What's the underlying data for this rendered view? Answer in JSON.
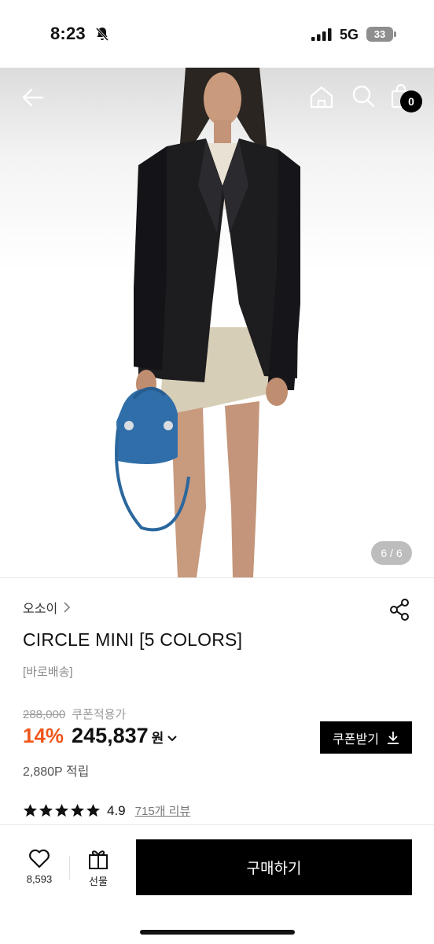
{
  "status_bar": {
    "time": "8:23",
    "network": "5G",
    "battery": "33"
  },
  "hero": {
    "page_counter": "6 / 6",
    "cart_count": "0"
  },
  "product": {
    "brand": "오소이",
    "title": "CIRCLE MINI [5 COLORS]",
    "shipping_tag": "[바로배송]",
    "original_price": "288,000",
    "coupon_price_label": "쿠폰적용가",
    "discount": "14%",
    "price": "245,837",
    "currency": "원",
    "coupon_button_label": "쿠폰받기",
    "points": "2,880P 적립",
    "rating": "4.9",
    "rating_value": 4.9,
    "review_link": "715개 리뷰"
  },
  "bottom_bar": {
    "wish_count": "8,593",
    "gift_label": "선물",
    "buy_label": "구매하기"
  },
  "colors": {
    "accent_discount": "#f0561a",
    "button_bg": "#000000"
  },
  "icons": [
    "bell-muted-icon",
    "signal-icon",
    "back-arrow-icon",
    "home-icon",
    "search-icon",
    "shopping-bag-icon",
    "share-icon",
    "chevron-right-icon",
    "chevron-down-icon",
    "download-icon",
    "star-icon",
    "heart-icon",
    "gift-icon"
  ]
}
